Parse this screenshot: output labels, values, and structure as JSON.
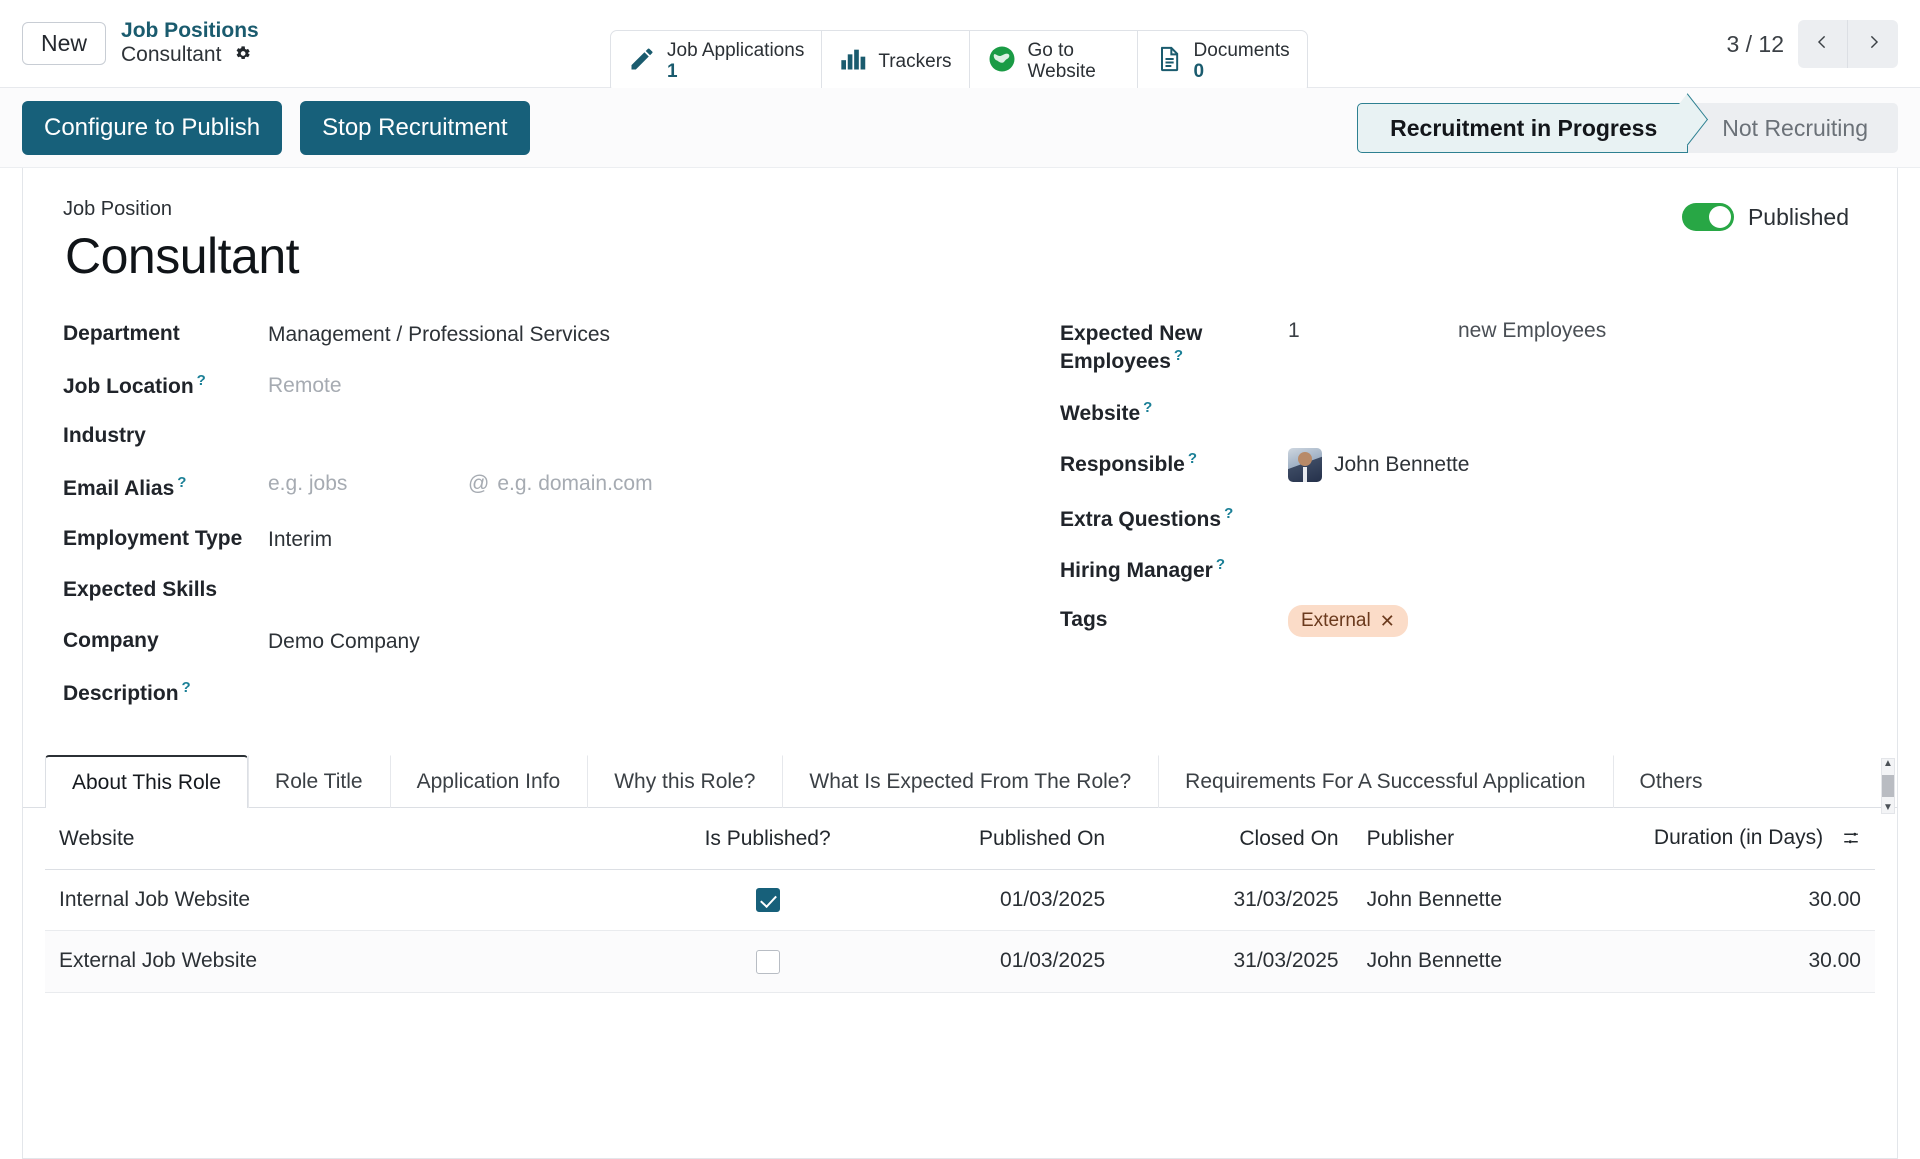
{
  "topbar": {
    "new_label": "New",
    "breadcrumb_parent": "Job Positions",
    "breadcrumb_current": "Consultant",
    "gear_icon": "gear-icon",
    "stat_buttons": [
      {
        "icon": "pencil-icon",
        "label": "Job Applications",
        "value": "1"
      },
      {
        "icon": "bar-chart-icon",
        "label": "Trackers",
        "value": ""
      },
      {
        "icon": "globe-icon",
        "label": "Go to Website",
        "value": ""
      },
      {
        "icon": "document-icon",
        "label": "Documents",
        "value": "0"
      }
    ],
    "pager": {
      "count": "3 / 12",
      "prev_icon": "chevron-left-icon",
      "next_icon": "chevron-right-icon"
    }
  },
  "statusrow": {
    "buttons": [
      {
        "label": "Configure to Publish"
      },
      {
        "label": "Stop Recruitment"
      }
    ],
    "stages": [
      {
        "label": "Recruitment in Progress",
        "active": true
      },
      {
        "label": "Not Recruiting",
        "active": false
      }
    ]
  },
  "sheet": {
    "publish": {
      "label": "Published",
      "on": true
    },
    "subtitle": "Job Position",
    "title": "Consultant",
    "left_fields": [
      {
        "label": "Department",
        "hint": false,
        "value": "Management / Professional Services",
        "placeholder": false
      },
      {
        "label": "Job Location",
        "hint": true,
        "value": "Remote",
        "placeholder": true
      },
      {
        "label": "Industry",
        "hint": false,
        "value": "",
        "placeholder": false
      },
      {
        "label": "Email Alias",
        "hint": true,
        "value": "",
        "placeholder": true
      },
      {
        "label": "Employment Type",
        "hint": false,
        "value": "Interim",
        "placeholder": false
      },
      {
        "label": "Expected Skills",
        "hint": false,
        "value": "",
        "placeholder": false
      },
      {
        "label": "Company",
        "hint": false,
        "value": "Demo Company",
        "placeholder": false
      },
      {
        "label": "Description",
        "hint": true,
        "value": "",
        "placeholder": false
      }
    ],
    "email_alias": {
      "local_placeholder": "e.g. jobs",
      "at": "@",
      "domain_placeholder": "e.g. domain.com"
    },
    "right_fields": {
      "expected_new_employees": {
        "label": "Expected New Employees",
        "hint": true,
        "value": "1",
        "suffix": "new Employees"
      },
      "website": {
        "label": "Website",
        "hint": true,
        "value": ""
      },
      "responsible": {
        "label": "Responsible",
        "hint": true,
        "value": "John Bennette",
        "avatar": "avatar"
      },
      "extra_questions": {
        "label": "Extra Questions",
        "hint": true,
        "value": ""
      },
      "hiring_manager": {
        "label": "Hiring Manager",
        "hint": true,
        "value": ""
      },
      "tags": {
        "label": "Tags",
        "hint": false,
        "items": [
          {
            "label": "External",
            "remove_icon": "close-icon"
          }
        ]
      }
    },
    "tabs": [
      {
        "label": "About This Role",
        "active": true
      },
      {
        "label": "Role Title",
        "active": false
      },
      {
        "label": "Application Info",
        "active": false
      },
      {
        "label": "Why this Role?",
        "active": false
      },
      {
        "label": "What Is Expected From The Role?",
        "active": false
      },
      {
        "label": "Requirements For A Successful Application",
        "active": false
      },
      {
        "label": "Others",
        "active": false
      }
    ],
    "table": {
      "columns": [
        "Website",
        "Is Published?",
        "Published On",
        "Closed On",
        "Publisher",
        "Duration (in Days)"
      ],
      "optional_columns_icon": "sliders-icon",
      "rows": [
        {
          "website": "Internal Job Website",
          "is_published": true,
          "published_on": "01/03/2025",
          "closed_on": "31/03/2025",
          "publisher": "John Bennette",
          "duration": "30.00"
        },
        {
          "website": "External Job Website",
          "is_published": false,
          "published_on": "01/03/2025",
          "closed_on": "31/03/2025",
          "publisher": "John Bennette",
          "duration": "30.00"
        }
      ]
    }
  },
  "colors": {
    "primary": "#17607a",
    "accent": "#1a5b6e",
    "toggle_on": "#28a745",
    "tag_bg": "#fbdcc8"
  }
}
